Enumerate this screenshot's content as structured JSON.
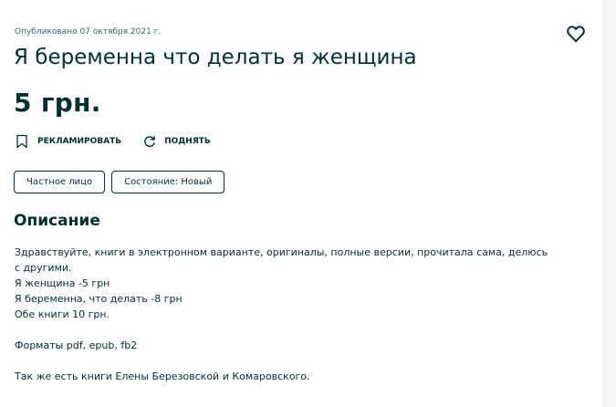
{
  "listing": {
    "published": "Опубликовано 07 октября 2021 г.",
    "title": "Я беременна что делать я женщина",
    "price": "5 грн."
  },
  "actions": {
    "promote_label": "РЕКЛАМИРОВАТЬ",
    "raise_label": "ПОДНЯТЬ"
  },
  "tags": [
    "Частное лицо",
    "Состояние: Новый"
  ],
  "description": {
    "heading": "Описание",
    "lines": [
      "Здравствуйте, книги в электронном варианте, оригиналы, полные версии, прочитала сама, делюсь",
      "с другими.",
      "Я женщина -5 грн",
      "Я беременна, что делать -8 грн",
      "Обе книги 10 грн.",
      "Форматы pdf, epub, fb2",
      "Так же есть книги Елены Березовской и Комаровского."
    ]
  },
  "icons": {
    "favorite": "heart-icon",
    "promote": "bookmark-icon",
    "raise": "refresh-icon"
  },
  "colors": {
    "text": "#002f34",
    "muted": "#406367",
    "background": "#ffffff"
  }
}
